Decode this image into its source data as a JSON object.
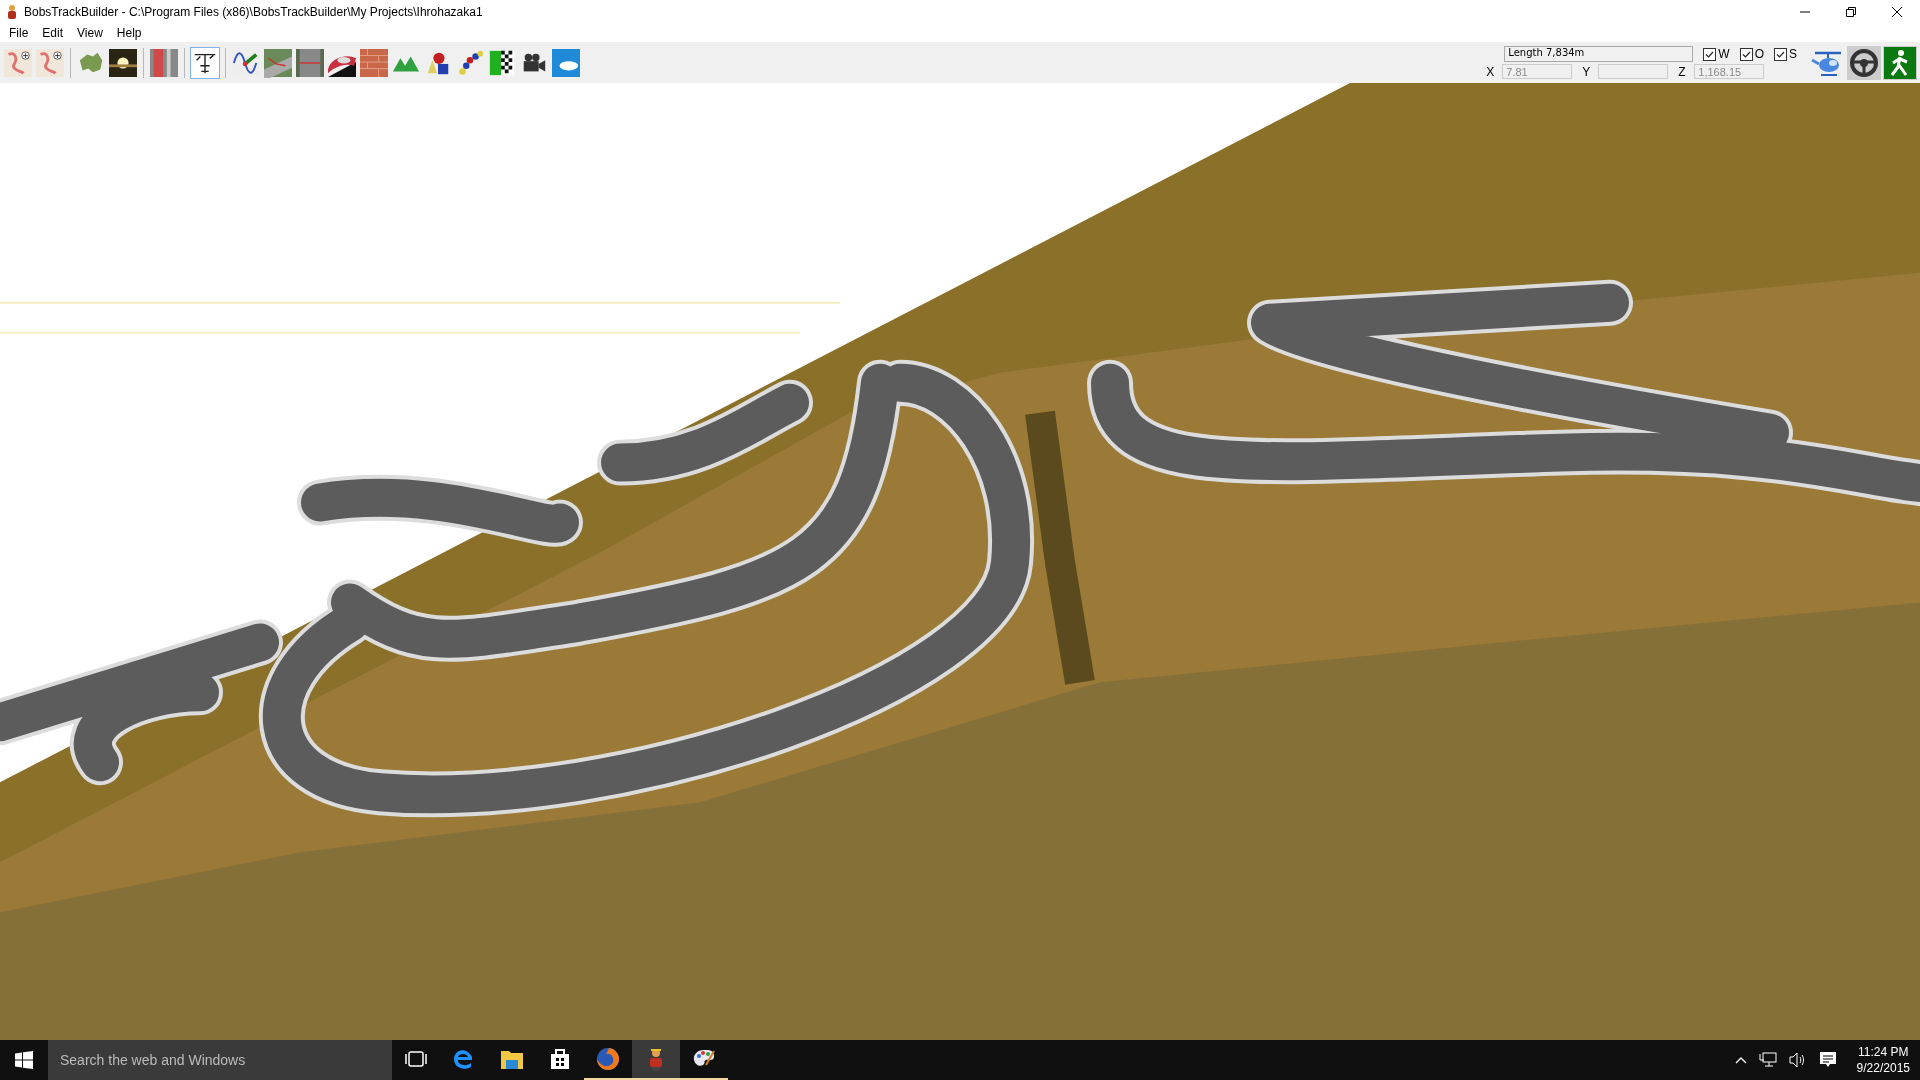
{
  "window": {
    "title": "BobsTrackBuilder - C:\\Program Files (x86)\\BobsTrackBuilder\\My Projects\\Ihrohazaka1"
  },
  "menu": [
    "File",
    "Edit",
    "View",
    "Help"
  ],
  "toolbar": {
    "tools": [
      {
        "selected": false
      },
      {
        "selected": false
      },
      {
        "selected": false
      },
      {
        "selected": false
      },
      {
        "selected": false
      },
      {
        "selected": true
      },
      {
        "selected": false
      },
      {
        "selected": false
      },
      {
        "selected": false
      },
      {
        "selected": false
      },
      {
        "selected": false
      },
      {
        "selected": false
      },
      {
        "selected": false
      },
      {
        "selected": false
      },
      {
        "selected": false
      },
      {
        "selected": false
      },
      {
        "selected": false
      }
    ]
  },
  "info": {
    "length": "Length 7,834m",
    "x_label": "X",
    "x_value": "7.81",
    "y_label": "Y",
    "z_label": "Z",
    "z_value": "1,168.15"
  },
  "layers": [
    {
      "label": "W",
      "checked": true
    },
    {
      "label": "O",
      "checked": true
    },
    {
      "label": "S",
      "checked": true
    }
  ],
  "taskbar": {
    "search": {
      "placeholder": "Search the web and Windows"
    },
    "apps": [
      {
        "running": false,
        "active": false
      },
      {
        "running": false,
        "active": false
      },
      {
        "running": false,
        "active": false
      },
      {
        "running": false,
        "active": false
      },
      {
        "running": true,
        "active": false
      },
      {
        "running": true,
        "active": true
      },
      {
        "running": true,
        "active": false
      }
    ],
    "time": "11:24 PM",
    "date": "9/22/2015"
  }
}
